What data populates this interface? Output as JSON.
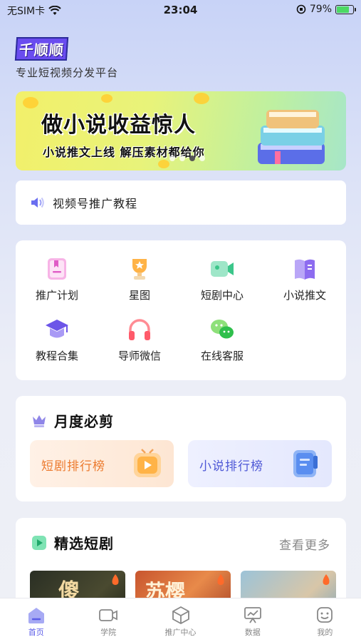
{
  "status_bar": {
    "carrier": "无SIM卡",
    "time": "23:04",
    "battery": "79%",
    "battery_level": 0.79
  },
  "brand": {
    "logo": "千顺顺",
    "tagline": "专业短视频分发平台"
  },
  "banner": {
    "title": "做小说收益惊人",
    "subtitle": "小说推文上线  解压素材都给你",
    "slide_count": 4,
    "active_slide": 3
  },
  "notice": {
    "text": "视频号推广教程"
  },
  "grid": {
    "items": [
      {
        "label": "推广计划",
        "icon": "bookmark-doc-icon"
      },
      {
        "label": "星图",
        "icon": "trophy-icon"
      },
      {
        "label": "短剧中心",
        "icon": "video-camera-icon"
      },
      {
        "label": "小说推文",
        "icon": "book-icon"
      },
      {
        "label": "教程合集",
        "icon": "graduation-cap-icon"
      },
      {
        "label": "导师微信",
        "icon": "headphones-icon"
      },
      {
        "label": "在线客服",
        "icon": "wechat-icon"
      }
    ]
  },
  "monthly": {
    "title": "月度必剪",
    "drama_rank": "短剧排行榜",
    "novel_rank": "小说排行榜"
  },
  "featured": {
    "title": "精选短剧",
    "more": "查看更多",
    "posters": [
      {
        "text": "傻"
      },
      {
        "text": "苏樱"
      },
      {
        "text": ""
      }
    ]
  },
  "tabs": [
    {
      "label": "首页",
      "icon": "home-icon",
      "active": true
    },
    {
      "label": "学院",
      "icon": "video-icon",
      "active": false
    },
    {
      "label": "推广中心",
      "icon": "cube-icon",
      "active": false
    },
    {
      "label": "数据",
      "icon": "chart-board-icon",
      "active": false
    },
    {
      "label": "我的",
      "icon": "smile-face-icon",
      "active": false
    }
  ],
  "colors": {
    "accent": "#5b5ce8",
    "drama": "#ec7a2e",
    "novel": "#4e58d6"
  }
}
